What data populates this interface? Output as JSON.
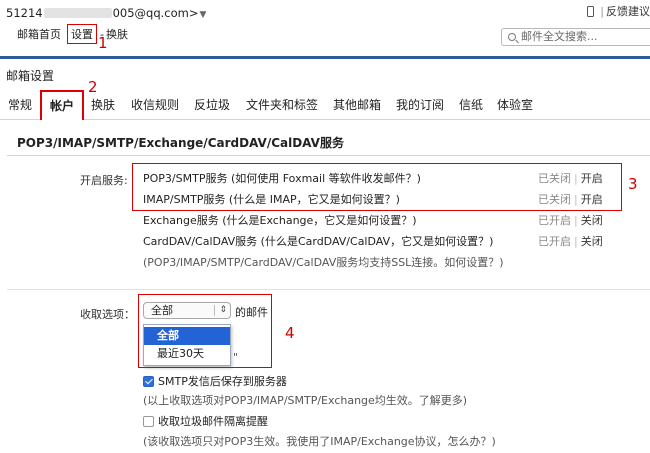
{
  "header": {
    "account_prefix": "51214",
    "account_suffix": "005@qq.com>",
    "account_caret": "▼",
    "feedback": "反馈建议"
  },
  "nav": {
    "home": "邮箱首页",
    "settings": "设置",
    "skin_sep": "-",
    "skin": "换肤"
  },
  "search": {
    "placeholder": "邮件全文搜索..."
  },
  "settings": {
    "title": "邮箱设置",
    "tabs": [
      "常规",
      "帐户",
      "换肤",
      "收信规则",
      "反垃圾",
      "文件夹和标签",
      "其他邮箱",
      "我的订阅",
      "信纸",
      "体验室"
    ]
  },
  "section": {
    "title": "POP3/IMAP/SMTP/Exchange/CardDAV/CalDAV服务",
    "enable_label": "开启服务:",
    "services": [
      {
        "name": "POP3/SMTP服务 (如何使用 Foxmail 等软件收发邮件？)",
        "status_a": "已关闭",
        "status_b": "开启"
      },
      {
        "name": "IMAP/SMTP服务 (什么是 IMAP，它又是如何设置？)",
        "status_a": "已关闭",
        "status_b": "开启"
      },
      {
        "name": "Exchange服务 (什么是Exchange，它又是如何设置？)",
        "status_a": "已开启",
        "status_b": "关闭"
      },
      {
        "name": "CardDAV/CalDAV服务 (什么是CardDAV/CalDAV，它又是如何设置？)",
        "status_a": "已开启",
        "status_b": "关闭"
      }
    ],
    "ssl_note": "(POP3/IMAP/SMTP/CardDAV/CalDAV服务均支持SSL连接。如何设置？)"
  },
  "fetch": {
    "label": "收取选项：",
    "selected": "全部",
    "suffix": "的邮件",
    "options": [
      "全部",
      "最近30天"
    ],
    "quote_fragment": "\"",
    "smtp_save": "SMTP发信后保存到服务器",
    "smtp_note": "(以上收取选项对POP3/IMAP/SMTP/Exchange均生效。了解更多)",
    "spam_isolate": "收取垃圾邮件隔离提醒",
    "spam_note": "(该收取选项只对POP3生效。我使用了IMAP/Exchange协议，怎么办？)"
  },
  "annotations": [
    "1",
    "2",
    "3",
    "4"
  ],
  "colors": {
    "accent": "#2e5a9a",
    "highlight": "#dd0000",
    "select_blue": "#2463d6"
  }
}
